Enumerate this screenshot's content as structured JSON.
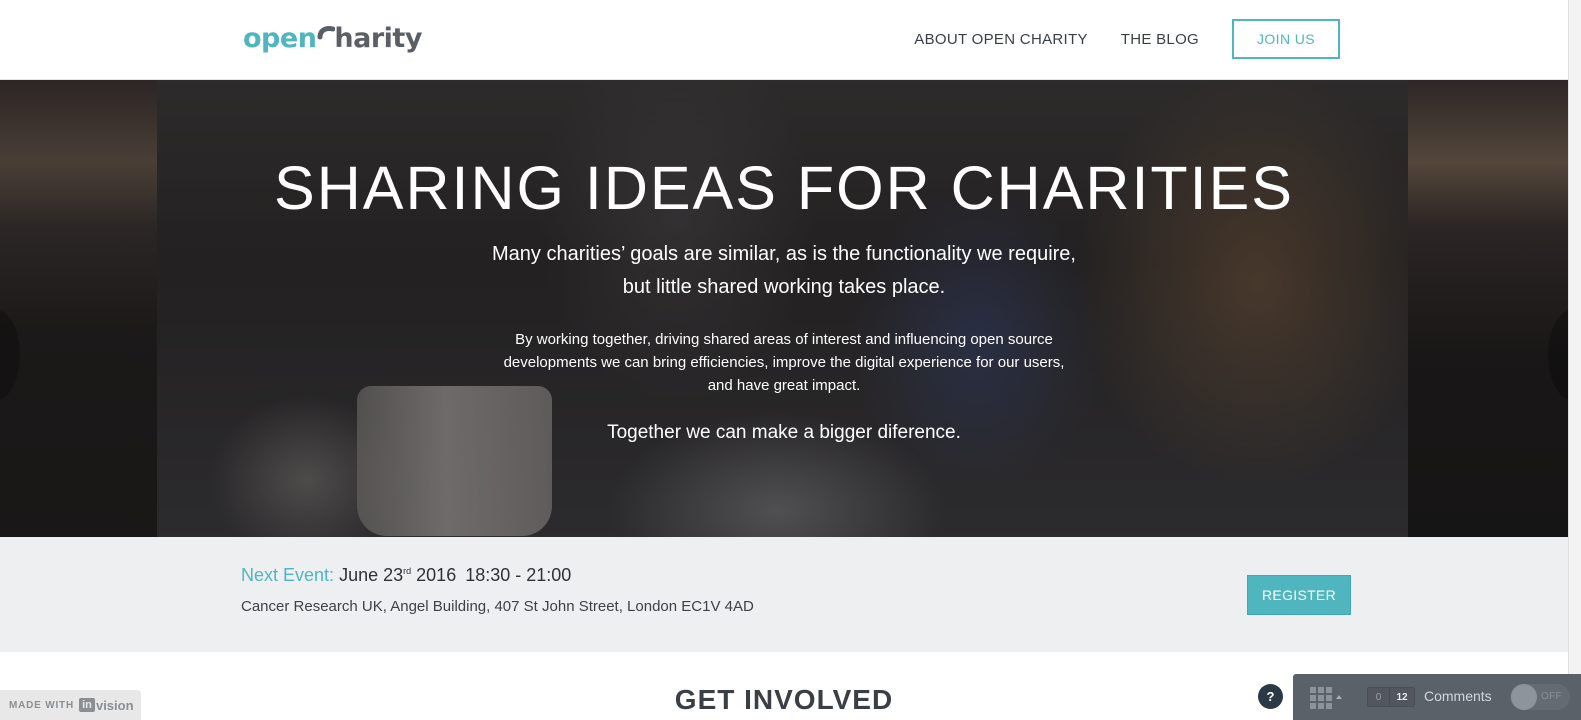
{
  "header": {
    "logo": {
      "part1": "open",
      "part2": "harity"
    },
    "nav": [
      {
        "label": "ABOUT OPEN CHARITY"
      },
      {
        "label": "THE BLOG"
      }
    ],
    "join_label": "JOIN US"
  },
  "hero": {
    "title": "SHARING IDEAS FOR CHARITIES",
    "lead": "Many charities’ goals are similar, as is the functionality we require, but little shared working takes place.",
    "body": "By working together, driving shared areas of interest and influencing open source developments we can bring efficiencies, improve the digital experience for our users, and have great impact.",
    "tagline": "Together we can make a bigger diference."
  },
  "event": {
    "label": "Next Event:",
    "date_day": "June 23",
    "date_suffix": "rd",
    "date_year": "2016",
    "time": "18:30 - 21:00",
    "address": "Cancer Research UK, Angel Building, 407 St John Street, London EC1V 4AD",
    "register_label": "REGISTER"
  },
  "section": {
    "get_involved": "GET INVOLVED"
  },
  "badge": {
    "made_with": "MADE WITH",
    "logo_in": "in",
    "logo_vision": "vision"
  },
  "help": {
    "label": "?"
  },
  "comments_toolbar": {
    "count_a": "0",
    "count_b": "12",
    "label": "Comments",
    "toggle_state": "OFF"
  },
  "colors": {
    "accent": "#4fb6bf",
    "text_dark": "#3a3f45",
    "event_bg": "#edeff0",
    "toolbar_bg": "#5b6169"
  }
}
